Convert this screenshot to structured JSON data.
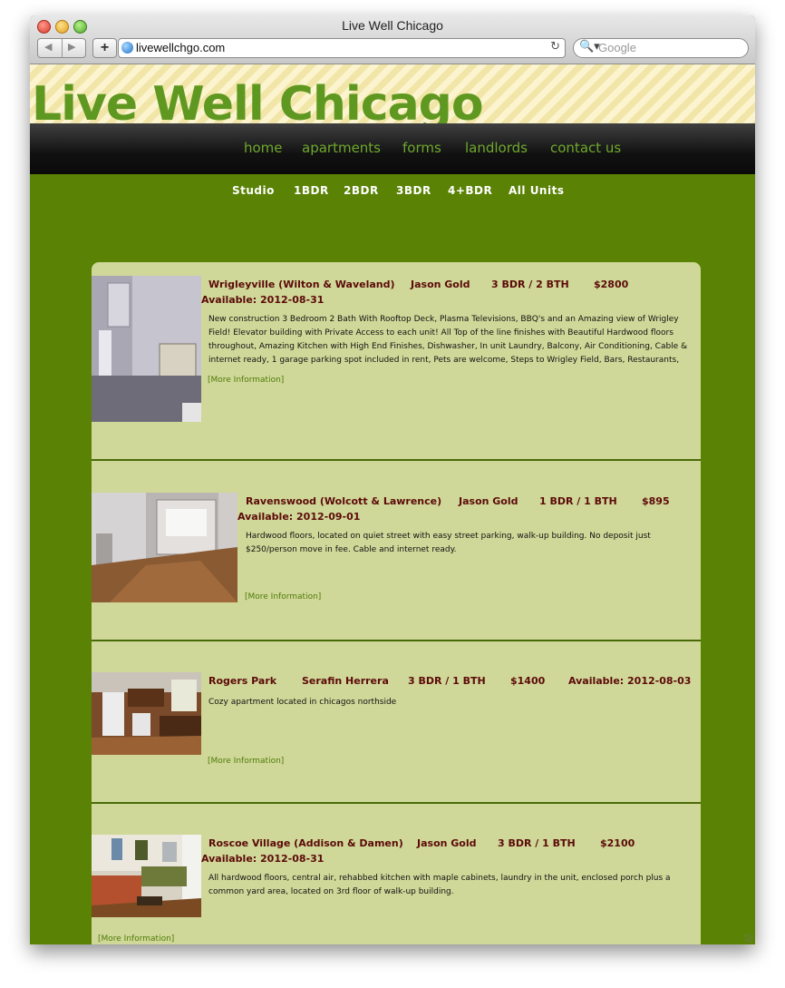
{
  "browser": {
    "window_title": "Live Well Chicago",
    "url": "livewellchgo.com",
    "search_placeholder": "Google",
    "back_glyph": "◀",
    "forward_glyph": "▶",
    "add_glyph": "+",
    "reload_glyph": "↻",
    "search_glyph": "🔍▾"
  },
  "site": {
    "title": "Live Well Chicago",
    "nav": {
      "home": "home",
      "apartments": "apartments",
      "forms": "forms",
      "landlords": "landlords",
      "contact": "contact us"
    },
    "subnav": {
      "studio": "Studio",
      "one": "1BDR",
      "two": "2BDR",
      "three": "3BDR",
      "four": "4+BDR",
      "all": "All Units"
    }
  },
  "listings": [
    {
      "location": "Wrigleyville (Wilton & Waveland)",
      "agent": "Jason Gold",
      "layout": "3 BDR / 2 BTH",
      "price": "$2800",
      "available": "Available: 2012-08-31",
      "description": "New construction 3 Bedroom 2 Bath With Rooftop Deck, Plasma Televisions, BBQ's and an Amazing view of Wrigley Field! Elevator building with Private Access to each unit! All Top of the line finishes with Beautiful Hardwood floors throughout, Amazing Kitchen with High End Finishes, Dishwasher, In unit Laundry, Balcony, Air Conditioning, Cable & internet ready, 1 garage parking spot included in rent, Pets are welcome, Steps to Wrigley Field, Bars, Restaurants,",
      "more": "[More Information]"
    },
    {
      "location": "Ravenswood (Wolcott & Lawrence)",
      "agent": "Jason Gold",
      "layout": "1 BDR / 1 BTH",
      "price": "$895",
      "available": "Available: 2012-09-01",
      "description": "Hardwood floors, located on quiet street with easy street parking, walk-up building. No deposit just $250/person move in fee. Cable and internet ready.",
      "more": "[More Information]"
    },
    {
      "location": "Rogers Park",
      "agent": "Serafin Herrera",
      "layout": "3 BDR / 1 BTH",
      "price": "$1400",
      "available": "Available: 2012-08-03",
      "description": "Cozy apartment located in chicagos northside",
      "more": "[More Information]"
    },
    {
      "location": "Roscoe Village (Addison & Damen)",
      "agent": "Jason Gold",
      "layout": "3 BDR / 1 BTH",
      "price": "$2100",
      "available": "Available: 2012-08-31",
      "description": "All hardwood floors, central air, rehabbed kitchen with maple cabinets, laundry in the unit, enclosed porch plus a common yard area, located on 3rd floor of walk-up building.",
      "more": "[More Information]"
    }
  ]
}
